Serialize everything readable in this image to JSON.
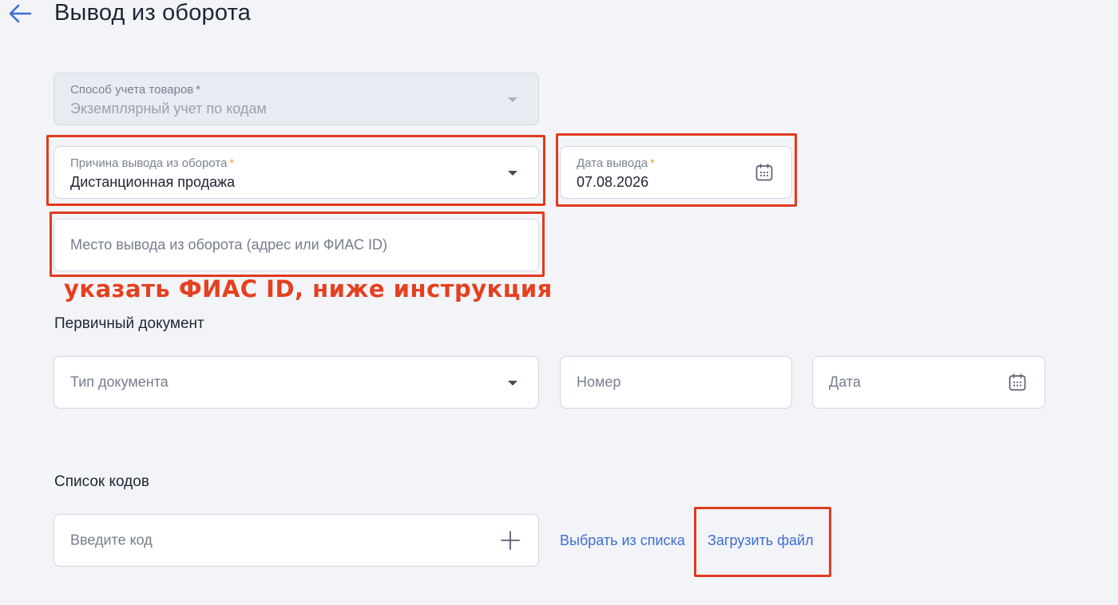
{
  "page": {
    "title": "Вывод из оборота"
  },
  "accounting_method": {
    "label": "Способ учета товаров",
    "required_mark": "*",
    "value": "Экземплярный учет по кодам"
  },
  "withdrawal_reason": {
    "label": "Причина вывода из оборота",
    "required_mark": "*",
    "value": "Дистанционная продажа"
  },
  "withdrawal_date": {
    "label": "Дата вывода",
    "required_mark": "*",
    "value": "07.08.2026"
  },
  "withdrawal_place": {
    "placeholder": "Место вывода из оборота (адрес или ФИАС ID)"
  },
  "annotation": {
    "text": "указать ФИАС ID, ниже инструкция"
  },
  "primary_document": {
    "title": "Первичный документ",
    "doc_type_placeholder": "Тип документа",
    "number_placeholder": "Номер",
    "date_placeholder": "Дата"
  },
  "codes": {
    "title": "Список кодов",
    "input_placeholder": "Введите код",
    "select_from_list": "Выбрать из списка",
    "upload_file": "Загрузить файл"
  },
  "colors": {
    "accent": "#3b6fd4",
    "required": "#f0a33a",
    "annotation": "#e03a1e",
    "background": "#f3f4f8"
  },
  "icons": [
    "back-arrow-icon",
    "chevron-down-icon",
    "calendar-icon",
    "plus-icon"
  ]
}
